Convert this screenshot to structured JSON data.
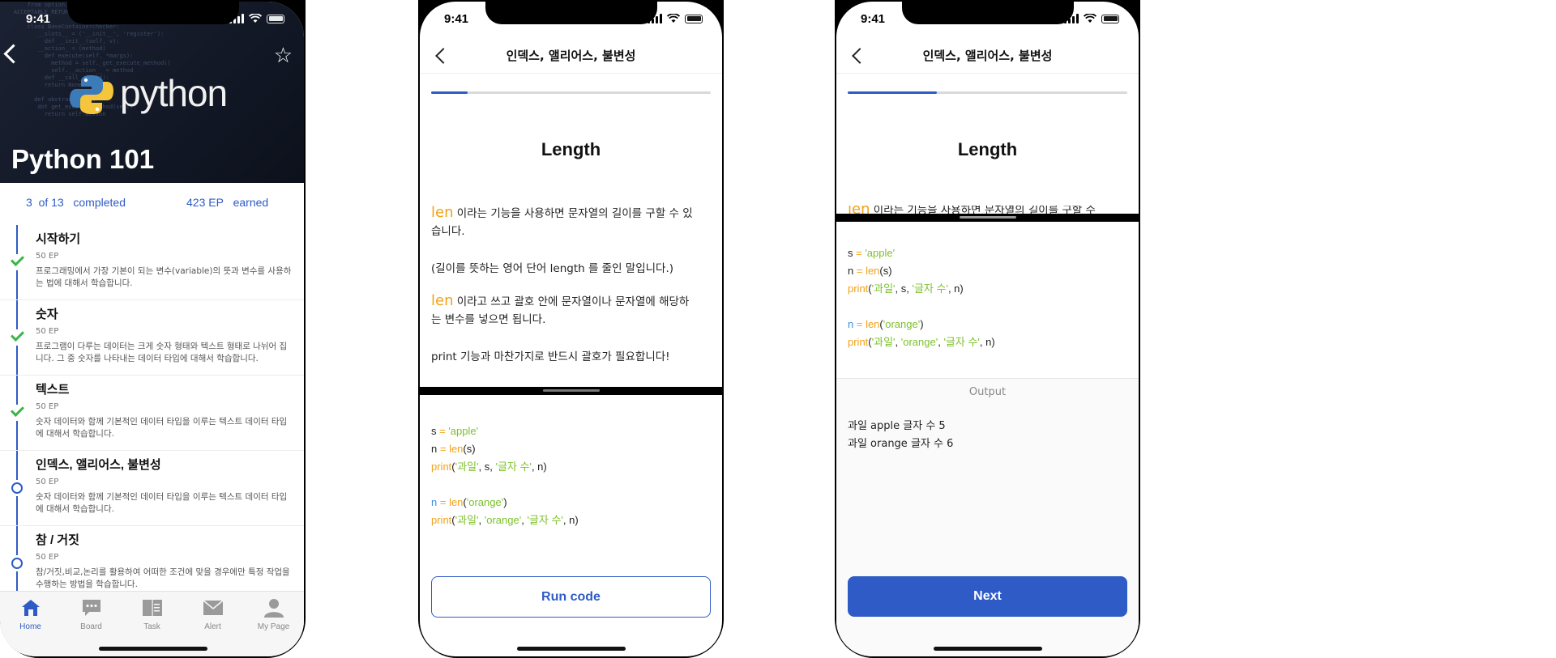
{
  "status": {
    "time": "9:41"
  },
  "course": {
    "title": "Python 101",
    "logo_text": "python",
    "progress": {
      "completed_count": "3",
      "of_total": "of 13",
      "completed_label": "completed",
      "ep": "423 EP",
      "ep_label": "earned"
    },
    "lessons": [
      {
        "title": "시작하기",
        "ep": "50 EP",
        "desc": "프로그래밍에서 가장 기본이 되는 변수(variable)의 뜻과 변수를 사용하는 법에 대해서 학습합니다.",
        "state": "completed"
      },
      {
        "title": "숫자",
        "ep": "50 EP",
        "desc": "프로그램이 다루는 데이터는 크게 숫자 형태와 텍스트 형태로 나뉘어 집니다. 그 중 숫자를 나타내는 데이터 타입에 대해서 학습합니다.",
        "state": "completed"
      },
      {
        "title": "텍스트",
        "ep": "50 EP",
        "desc": "숫자 데이터와 함께 기본적인 데이터 타입을 이루는 텍스트 데이터 타입에 대해서 학습합니다.",
        "state": "completed"
      },
      {
        "title": "인덱스, 앨리어스, 불변성",
        "ep": "50 EP",
        "desc": "숫자 데이터와 함께 기본적인 데이터 타입을 이루는 텍스트 데이터 타입에 대해서 학습합니다.",
        "state": "current"
      },
      {
        "title": "참 / 거짓",
        "ep": "50 EP",
        "desc": "참/거짓,비교,논리를 활용하여 어떠한 조건에 맞을 경우에만 특정 작업을 수행하는 방법을 학습합니다.",
        "state": "current"
      }
    ]
  },
  "tabs": [
    {
      "label": "Home",
      "icon": "home-icon",
      "active": true
    },
    {
      "label": "Board",
      "icon": "chat-icon",
      "active": false
    },
    {
      "label": "Task",
      "icon": "book-icon",
      "active": false
    },
    {
      "label": "Alert",
      "icon": "mail-icon",
      "active": false
    },
    {
      "label": "My Page",
      "icon": "person-icon",
      "active": false
    }
  ],
  "lesson_screen": {
    "nav_title": "인덱스, 앨리어스, 불변성",
    "heading": "Length",
    "progress_step1": 0.13,
    "progress_step2": 0.32,
    "para1_kw": "len",
    "para1_text": " 이라는 기능을 사용하면 문자열의 길이를 구할 수 있습니다.",
    "para2": "(길이를 뜻하는 영어 단어 length 를 줄인 말입니다.)",
    "para3_kw": "len",
    "para3_text": " 이라고 쓰고 괄호 안에 문자열이나 문자열에 해당하는 변수를 넣으면 됩니다.",
    "para4": "print 기능과 마찬가지로 반드시 괄호가 필요합니다!",
    "peek_text": " 이라는 기능을 사용하면 문자열의 길이를 구할 수",
    "code": {
      "l1a": "s",
      "l1b": " = ",
      "l1c": "'apple'",
      "l2a": "n",
      "l2b": " = ",
      "l2c": "len",
      "l2d": "(s)",
      "l3a": "print",
      "l3b": "(",
      "l3c": "'과일'",
      "l3d": ", s, ",
      "l3e": "'글자 수'",
      "l3f": ", n)",
      "l4a": "n",
      "l4b": " = ",
      "l4c": "len",
      "l4d": "(",
      "l4e": "'orange'",
      "l4f": ")",
      "l5a": "print",
      "l5b": "(",
      "l5c": "'과일'",
      "l5d": ", ",
      "l5e": "'orange'",
      "l5f": ", ",
      "l5g": "'글자 수'",
      "l5h": ", n)"
    },
    "run_button": "Run code",
    "output_label": "Output",
    "output_text": "과일 apple 글자 수 5\n과일 orange 글자 수 6",
    "next_button": "Next"
  }
}
